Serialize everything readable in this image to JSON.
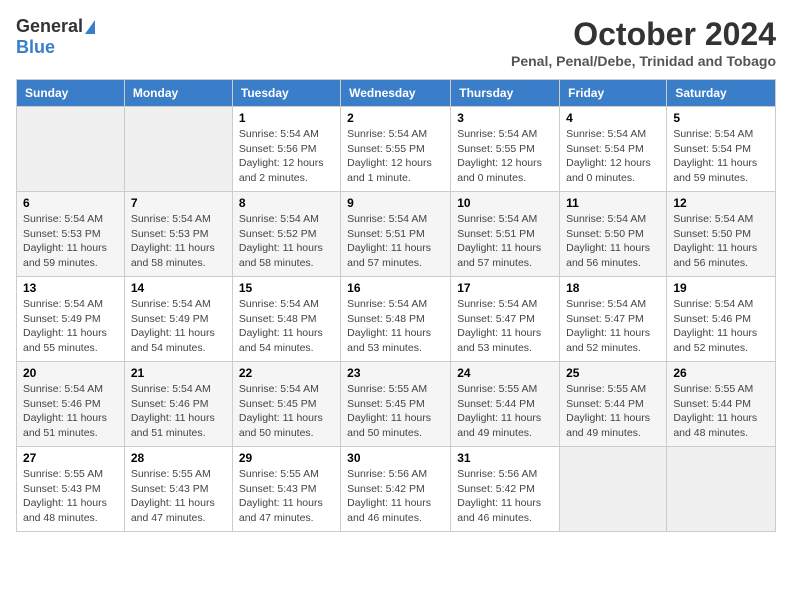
{
  "header": {
    "logo_general": "General",
    "logo_blue": "Blue",
    "month_title": "October 2024",
    "subtitle": "Penal, Penal/Debe, Trinidad and Tobago"
  },
  "days_of_week": [
    "Sunday",
    "Monday",
    "Tuesday",
    "Wednesday",
    "Thursday",
    "Friday",
    "Saturday"
  ],
  "weeks": [
    [
      {
        "day": "",
        "info": ""
      },
      {
        "day": "",
        "info": ""
      },
      {
        "day": "1",
        "info": "Sunrise: 5:54 AM\nSunset: 5:56 PM\nDaylight: 12 hours\nand 2 minutes."
      },
      {
        "day": "2",
        "info": "Sunrise: 5:54 AM\nSunset: 5:55 PM\nDaylight: 12 hours\nand 1 minute."
      },
      {
        "day": "3",
        "info": "Sunrise: 5:54 AM\nSunset: 5:55 PM\nDaylight: 12 hours\nand 0 minutes."
      },
      {
        "day": "4",
        "info": "Sunrise: 5:54 AM\nSunset: 5:54 PM\nDaylight: 12 hours\nand 0 minutes."
      },
      {
        "day": "5",
        "info": "Sunrise: 5:54 AM\nSunset: 5:54 PM\nDaylight: 11 hours\nand 59 minutes."
      }
    ],
    [
      {
        "day": "6",
        "info": "Sunrise: 5:54 AM\nSunset: 5:53 PM\nDaylight: 11 hours\nand 59 minutes."
      },
      {
        "day": "7",
        "info": "Sunrise: 5:54 AM\nSunset: 5:53 PM\nDaylight: 11 hours\nand 58 minutes."
      },
      {
        "day": "8",
        "info": "Sunrise: 5:54 AM\nSunset: 5:52 PM\nDaylight: 11 hours\nand 58 minutes."
      },
      {
        "day": "9",
        "info": "Sunrise: 5:54 AM\nSunset: 5:51 PM\nDaylight: 11 hours\nand 57 minutes."
      },
      {
        "day": "10",
        "info": "Sunrise: 5:54 AM\nSunset: 5:51 PM\nDaylight: 11 hours\nand 57 minutes."
      },
      {
        "day": "11",
        "info": "Sunrise: 5:54 AM\nSunset: 5:50 PM\nDaylight: 11 hours\nand 56 minutes."
      },
      {
        "day": "12",
        "info": "Sunrise: 5:54 AM\nSunset: 5:50 PM\nDaylight: 11 hours\nand 56 minutes."
      }
    ],
    [
      {
        "day": "13",
        "info": "Sunrise: 5:54 AM\nSunset: 5:49 PM\nDaylight: 11 hours\nand 55 minutes."
      },
      {
        "day": "14",
        "info": "Sunrise: 5:54 AM\nSunset: 5:49 PM\nDaylight: 11 hours\nand 54 minutes."
      },
      {
        "day": "15",
        "info": "Sunrise: 5:54 AM\nSunset: 5:48 PM\nDaylight: 11 hours\nand 54 minutes."
      },
      {
        "day": "16",
        "info": "Sunrise: 5:54 AM\nSunset: 5:48 PM\nDaylight: 11 hours\nand 53 minutes."
      },
      {
        "day": "17",
        "info": "Sunrise: 5:54 AM\nSunset: 5:47 PM\nDaylight: 11 hours\nand 53 minutes."
      },
      {
        "day": "18",
        "info": "Sunrise: 5:54 AM\nSunset: 5:47 PM\nDaylight: 11 hours\nand 52 minutes."
      },
      {
        "day": "19",
        "info": "Sunrise: 5:54 AM\nSunset: 5:46 PM\nDaylight: 11 hours\nand 52 minutes."
      }
    ],
    [
      {
        "day": "20",
        "info": "Sunrise: 5:54 AM\nSunset: 5:46 PM\nDaylight: 11 hours\nand 51 minutes."
      },
      {
        "day": "21",
        "info": "Sunrise: 5:54 AM\nSunset: 5:46 PM\nDaylight: 11 hours\nand 51 minutes."
      },
      {
        "day": "22",
        "info": "Sunrise: 5:54 AM\nSunset: 5:45 PM\nDaylight: 11 hours\nand 50 minutes."
      },
      {
        "day": "23",
        "info": "Sunrise: 5:55 AM\nSunset: 5:45 PM\nDaylight: 11 hours\nand 50 minutes."
      },
      {
        "day": "24",
        "info": "Sunrise: 5:55 AM\nSunset: 5:44 PM\nDaylight: 11 hours\nand 49 minutes."
      },
      {
        "day": "25",
        "info": "Sunrise: 5:55 AM\nSunset: 5:44 PM\nDaylight: 11 hours\nand 49 minutes."
      },
      {
        "day": "26",
        "info": "Sunrise: 5:55 AM\nSunset: 5:44 PM\nDaylight: 11 hours\nand 48 minutes."
      }
    ],
    [
      {
        "day": "27",
        "info": "Sunrise: 5:55 AM\nSunset: 5:43 PM\nDaylight: 11 hours\nand 48 minutes."
      },
      {
        "day": "28",
        "info": "Sunrise: 5:55 AM\nSunset: 5:43 PM\nDaylight: 11 hours\nand 47 minutes."
      },
      {
        "day": "29",
        "info": "Sunrise: 5:55 AM\nSunset: 5:43 PM\nDaylight: 11 hours\nand 47 minutes."
      },
      {
        "day": "30",
        "info": "Sunrise: 5:56 AM\nSunset: 5:42 PM\nDaylight: 11 hours\nand 46 minutes."
      },
      {
        "day": "31",
        "info": "Sunrise: 5:56 AM\nSunset: 5:42 PM\nDaylight: 11 hours\nand 46 minutes."
      },
      {
        "day": "",
        "info": ""
      },
      {
        "day": "",
        "info": ""
      }
    ]
  ]
}
